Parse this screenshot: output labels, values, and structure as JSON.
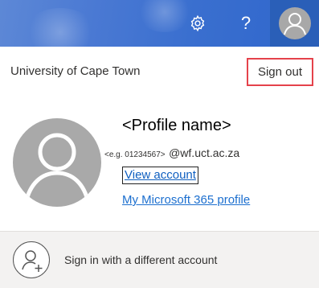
{
  "header": {
    "settings_icon": "gear-icon",
    "help_label": "?",
    "account_icon": "person-icon"
  },
  "account_panel": {
    "organization": "University of Cape Town",
    "sign_out_label": "Sign out",
    "profile_name": "<Profile name>",
    "email_prefix": "<e.g. 01234567>",
    "email_domain": "@wf.uct.ac.za",
    "view_account_label": "View account",
    "ms_profile_label": "My Microsoft 365 profile",
    "highlight_color": "#e5424b",
    "link_color": "#0f5fc0"
  },
  "footer": {
    "icon": "add-person-icon",
    "label": "Sign in with a different account"
  }
}
